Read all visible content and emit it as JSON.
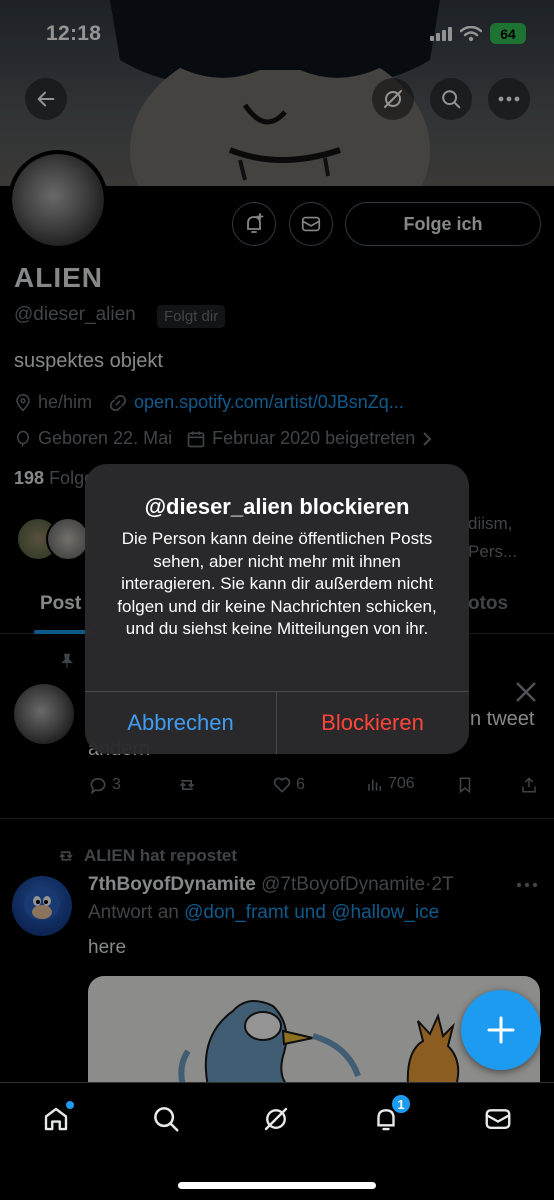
{
  "status_bar": {
    "time": "12:18",
    "battery": "64"
  },
  "profile": {
    "display_name": "ALIEN",
    "handle": "@dieser_alien",
    "follows_you": "Folgt dir",
    "follow_button": "Folge ich",
    "bio": "suspektes objekt",
    "pronouns": "he/him",
    "link": "open.spotify.com/artist/0JBsnZq...",
    "birthday": "Geboren 22. Mai",
    "joined": "Februar 2020 beigetreten",
    "followers_count": "198",
    "followers_label": "Folge",
    "followed_by_fragment1": "diism,",
    "followed_by_fragment2": "Pers..."
  },
  "tabs": {
    "posts": "Post",
    "photos": "otos"
  },
  "pinned_post": {
    "text_fragment1": "n tweet",
    "text_fragment2": "andern",
    "replies": "3",
    "likes": "6",
    "views": "706"
  },
  "repost": {
    "label": "ALIEN hat repostet",
    "author_name": "7thBoyofDynamite",
    "author_handle": "@7tBoyofDynamite",
    "time": "2T",
    "reply_prefix": "Antwort an",
    "reply_user1": "@don_framt",
    "reply_and": "und",
    "reply_user2": "@hallow_ice",
    "body": "here"
  },
  "dialog": {
    "title": "@dieser_alien blockieren",
    "message": "Die Person kann deine öffentlichen Posts sehen, aber nicht mehr mit ihnen interagieren. Sie kann dir außerdem nicht folgen und dir keine Nachrichten schicken, und du siehst keine Mitteilungen von ihr.",
    "cancel": "Abbrechen",
    "confirm": "Blockieren"
  },
  "nav": {
    "notifications_badge": "1"
  },
  "colors": {
    "accent": "#1d9bf0",
    "destructive": "#ff453a",
    "dialog_link": "#3e9cf2",
    "battery": "#34c759"
  }
}
